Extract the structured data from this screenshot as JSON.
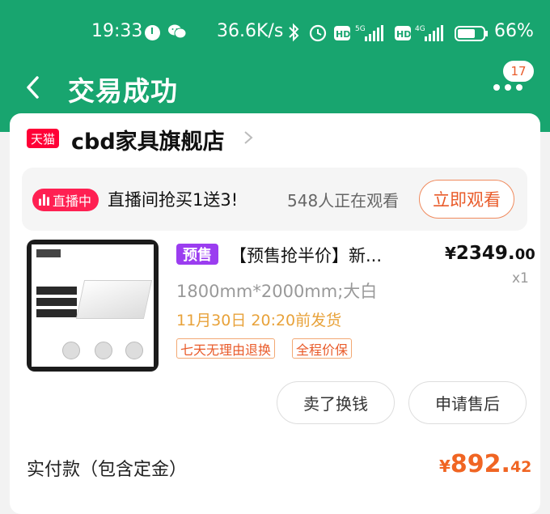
{
  "status_bar": {
    "time": "19:33",
    "speed": "36.6K/s",
    "battery": "66%"
  },
  "nav": {
    "title": "交易成功",
    "badge_count": "17"
  },
  "shop": {
    "logo_text": "天猫",
    "name": "cbd家具旗舰店"
  },
  "live": {
    "badge": "直播中",
    "text": "直播间抢买1送3!",
    "viewers": "548人正在观看",
    "button": "立即观看"
  },
  "product": {
    "presale_tag": "预售",
    "title": "【预售抢半价】新...",
    "price_symbol": "¥",
    "price_int": "2349.",
    "price_dec": "00",
    "quantity": "x1",
    "spec": "1800mm*2000mm;大白",
    "shipping": "11月30日 20:20前发货",
    "policies": [
      "七天无理由退换",
      "全程价保"
    ]
  },
  "actions": {
    "sell": "卖了换钱",
    "after_sale": "申请售后"
  },
  "payment": {
    "label": "实付款（包含定金）",
    "symbol": "¥",
    "amount_int": "892.",
    "amount_dec": "42"
  },
  "colors": {
    "header_green": "#18a56f",
    "accent_orange": "#f06523",
    "presale_purple": "#9b3df0",
    "live_red": "#ff2052"
  }
}
